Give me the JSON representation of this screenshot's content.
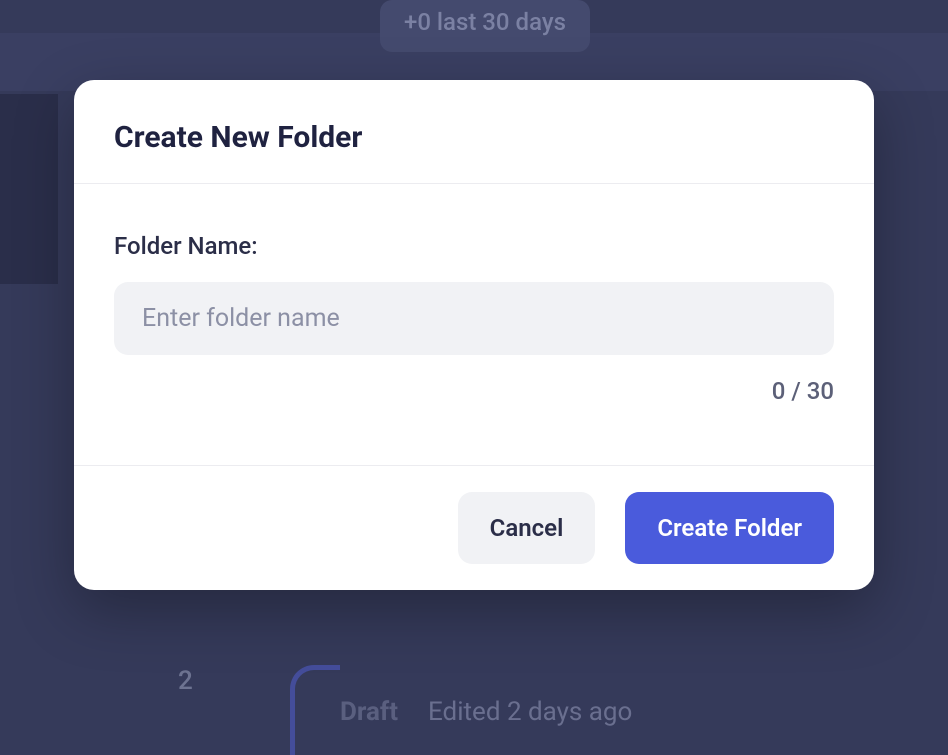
{
  "background": {
    "stat_text": "+0 last 30 days",
    "number": "2",
    "draft_label": "Draft",
    "edited_text": "Edited 2 days ago"
  },
  "modal": {
    "title": "Create New Folder",
    "field_label": "Folder Name:",
    "input_placeholder": "Enter folder name",
    "input_value": "",
    "char_counter": "0 / 30",
    "cancel_label": "Cancel",
    "submit_label": "Create Folder"
  }
}
